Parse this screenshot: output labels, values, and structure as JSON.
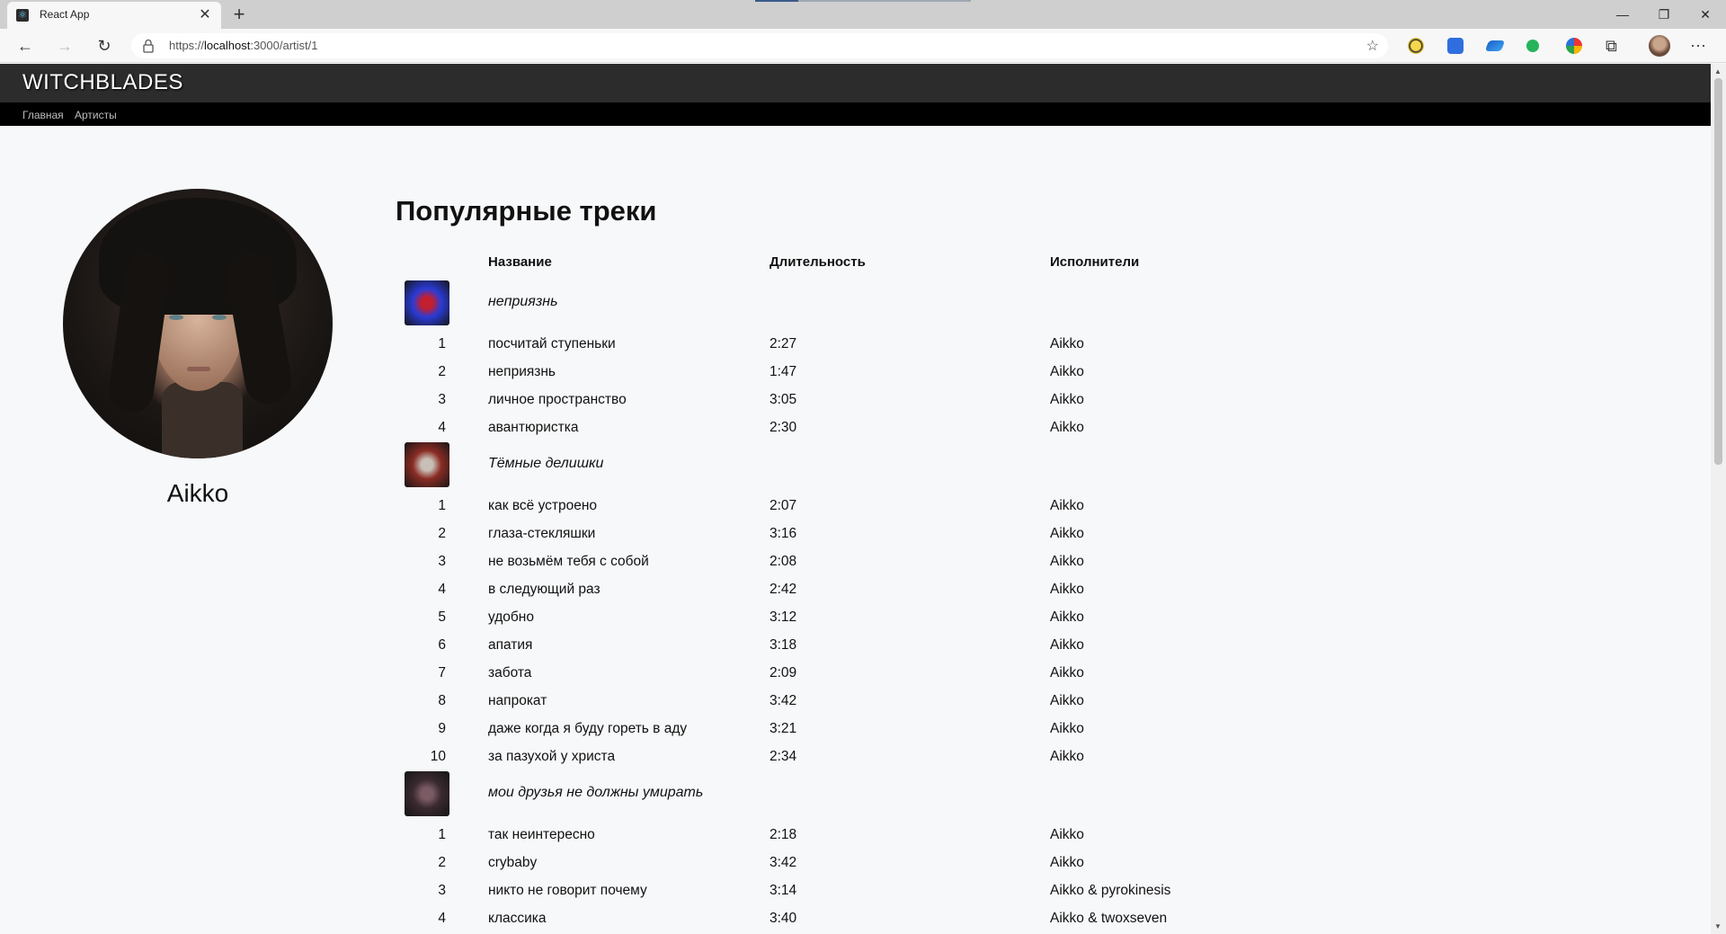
{
  "browser": {
    "tab_title": "React App",
    "url_prefix": "https://",
    "url_host": "localhost",
    "url_path": ":3000/artist/1",
    "extensions": [
      "norton-icon",
      "translate-icon",
      "cloud-icon",
      "leaf-icon",
      "circle-ext-icon",
      "puzzle-icon"
    ]
  },
  "site": {
    "brand": "WITCHBLADES",
    "nav": [
      "Главная",
      "Артисты"
    ]
  },
  "artist": {
    "name": "Aikko"
  },
  "tracks_section": {
    "title": "Популярные треки",
    "headers": {
      "name": "Название",
      "duration": "Длительность",
      "artists": "Исполнители"
    },
    "albums": [
      {
        "title": "неприязнь",
        "cover_colors": [
          "#2a3bd6",
          "#c21f2f"
        ],
        "tracks": [
          {
            "n": "1",
            "name": "посчитай ступеньки",
            "duration": "2:27",
            "artists": "Aikko"
          },
          {
            "n": "2",
            "name": "неприязнь",
            "duration": "1:47",
            "artists": "Aikko"
          },
          {
            "n": "3",
            "name": "личное пространство",
            "duration": "3:05",
            "artists": "Aikko"
          },
          {
            "n": "4",
            "name": "авантюристка",
            "duration": "2:30",
            "artists": "Aikko"
          }
        ]
      },
      {
        "title": "Тёмные делишки",
        "cover_colors": [
          "#8a2c24",
          "#c8c0b6"
        ],
        "tracks": [
          {
            "n": "1",
            "name": "как всё устроено",
            "duration": "2:07",
            "artists": "Aikko"
          },
          {
            "n": "2",
            "name": "глаза-стекляшки",
            "duration": "3:16",
            "artists": "Aikko"
          },
          {
            "n": "3",
            "name": "не возьмём тебя с собой",
            "duration": "2:08",
            "artists": "Aikko"
          },
          {
            "n": "4",
            "name": "в следующий раз",
            "duration": "2:42",
            "artists": "Aikko"
          },
          {
            "n": "5",
            "name": "удобно",
            "duration": "3:12",
            "artists": "Aikko"
          },
          {
            "n": "6",
            "name": "апатия",
            "duration": "3:18",
            "artists": "Aikko"
          },
          {
            "n": "7",
            "name": "забота",
            "duration": "2:09",
            "artists": "Aikko"
          },
          {
            "n": "8",
            "name": "напрокат",
            "duration": "3:42",
            "artists": "Aikko"
          },
          {
            "n": "9",
            "name": "даже когда я буду гореть в аду",
            "duration": "3:21",
            "artists": "Aikko"
          },
          {
            "n": "10",
            "name": "за пазухой у христа",
            "duration": "2:34",
            "artists": "Aikko"
          }
        ]
      },
      {
        "title": "мои друзья не должны умирать",
        "cover_colors": [
          "#3a2a30",
          "#7a5b64"
        ],
        "tracks": [
          {
            "n": "1",
            "name": "так неинтересно",
            "duration": "2:18",
            "artists": "Aikko"
          },
          {
            "n": "2",
            "name": "crybaby",
            "duration": "3:42",
            "artists": "Aikko"
          },
          {
            "n": "3",
            "name": "никто не говорит почему",
            "duration": "3:14",
            "artists": "Aikko & pyrokinesis"
          },
          {
            "n": "4",
            "name": "классика",
            "duration": "3:40",
            "artists": "Aikko & twoxseven"
          }
        ]
      }
    ]
  },
  "scroll_position": 0
}
